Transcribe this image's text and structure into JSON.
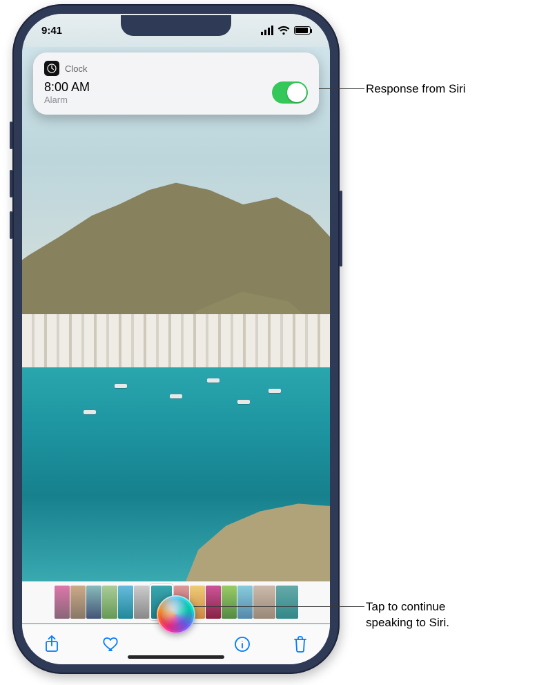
{
  "statusbar": {
    "time": "9:41"
  },
  "notif": {
    "app_name": "Clock",
    "alarm_time": "8:00 AM",
    "alarm_label": "Alarm",
    "toggle_on": true
  },
  "toolbar": {
    "share_name": "share-icon",
    "favorite_name": "heart-icon",
    "info_name": "info-icon",
    "delete_name": "trash-icon"
  },
  "siri": {
    "name": "siri-orb"
  },
  "callouts": {
    "response": "Response from Siri",
    "tap_line1": "Tap to continue",
    "tap_line2": "speaking to Siri."
  }
}
